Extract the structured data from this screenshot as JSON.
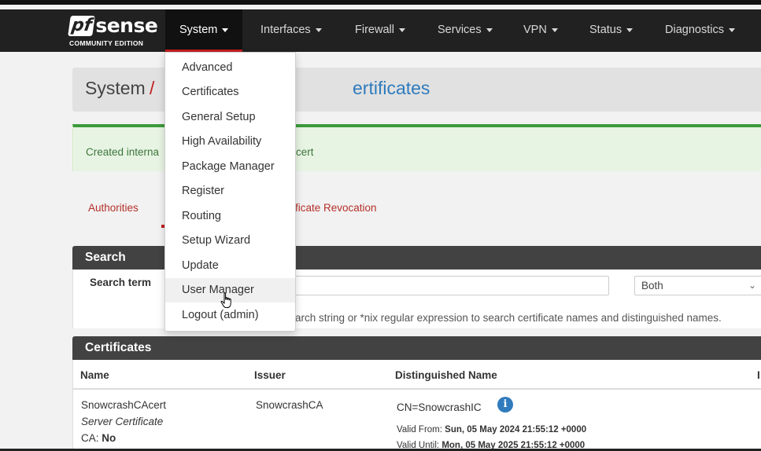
{
  "brand": {
    "logo_pf": "pf",
    "logo_sense": "sense",
    "edition": "COMMUNITY EDITION"
  },
  "nav": {
    "items": [
      {
        "label": "System"
      },
      {
        "label": "Interfaces"
      },
      {
        "label": "Firewall"
      },
      {
        "label": "Services"
      },
      {
        "label": "VPN"
      },
      {
        "label": "Status"
      },
      {
        "label": "Diagnostics"
      }
    ]
  },
  "system_menu": {
    "items": [
      {
        "label": "Advanced"
      },
      {
        "label": "Certificates"
      },
      {
        "label": "General Setup"
      },
      {
        "label": "High Availability"
      },
      {
        "label": "Package Manager"
      },
      {
        "label": "Register"
      },
      {
        "label": "Routing"
      },
      {
        "label": "Setup Wizard"
      },
      {
        "label": "Update"
      },
      {
        "label": "User Manager"
      },
      {
        "label": "Logout (admin)"
      }
    ],
    "hovered": "User Manager"
  },
  "page_header": {
    "section": "System",
    "separator": "/",
    "visible_title_fragment": "ertificates"
  },
  "alert": {
    "text_left": "Created interna",
    "text_right": "cert"
  },
  "tabs": {
    "authorities": "Authorities",
    "revocation_fragment": "ficate Revocation"
  },
  "search_panel": {
    "title": "Search",
    "term_label": "Search term",
    "input_value": "",
    "scope_selected": "Both",
    "help_fragment": "arch string or *nix regular expression to search certificate names and distinguished names."
  },
  "certificates_panel": {
    "title": "Certificates",
    "columns": [
      "Name",
      "Issuer",
      "Distinguished Name",
      "I"
    ],
    "rows": [
      {
        "name": "SnowcrashCAcert",
        "type": "Server Certificate",
        "ca_label": "CA:",
        "ca_value": "No",
        "issuer": "SnowcrashCA",
        "dn": "CN=SnowcrashIC",
        "valid_from_label": "Valid From:",
        "valid_from": "Sun, 05 May 2024 21:55:12 +0000",
        "valid_until_label": "Valid Until:",
        "valid_until": "Mon, 05 May 2025 21:55:12 +0000"
      }
    ]
  },
  "colors": {
    "navbar": "#212121",
    "accent_red": "#c21e1e",
    "link_blue": "#2f7bbd",
    "success_green": "#3c9a3c",
    "panel_header": "#424242"
  }
}
